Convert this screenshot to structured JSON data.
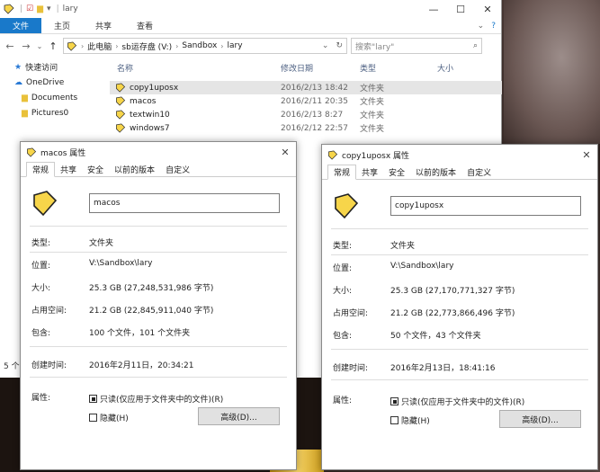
{
  "explorer": {
    "title": "lary",
    "window_controls": {
      "minimize": "—",
      "maximize": "☐",
      "close": "✕"
    },
    "ribbon_tabs": [
      "文件",
      "主页",
      "共享",
      "查看"
    ],
    "address": {
      "crumbs": [
        "此电脑",
        "sb运存盘 (V:)",
        "Sandbox",
        "lary"
      ],
      "sep": "›"
    },
    "search_placeholder": "搜索\"lary\"",
    "nav": [
      {
        "label": "快速访问",
        "icon": "star-icon",
        "sub": false
      },
      {
        "label": "OneDrive",
        "icon": "cloud-icon",
        "sub": false
      },
      {
        "label": "Documents",
        "icon": "folder-icon",
        "sub": true
      },
      {
        "label": "Pictures0",
        "icon": "folder-icon",
        "sub": true
      }
    ],
    "columns": {
      "name": "名称",
      "date": "修改日期",
      "type": "类型",
      "size": "大小"
    },
    "files": [
      {
        "name": "copy1uposx",
        "date": "2016/2/13 18:42",
        "type": "文件夹",
        "size": ""
      },
      {
        "name": "macos",
        "date": "2016/2/11 20:35",
        "type": "文件夹",
        "size": ""
      },
      {
        "name": "textwin10",
        "date": "2016/2/13 8:27",
        "type": "文件夹",
        "size": ""
      },
      {
        "name": "windows7",
        "date": "2016/2/12 22:57",
        "type": "文件夹",
        "size": ""
      }
    ],
    "status_text": "5 个"
  },
  "dialog_left": {
    "title": "macos 属性",
    "tabs": [
      "常规",
      "共享",
      "安全",
      "以前的版本",
      "自定义"
    ],
    "name": "macos",
    "rows": [
      {
        "label": "类型:",
        "value": "文件夹"
      },
      {
        "label": "位置:",
        "value": "V:\\Sandbox\\lary"
      },
      {
        "label": "大小:",
        "value": "25.3 GB (27,248,531,986 字节)"
      },
      {
        "label": "占用空间:",
        "value": "21.2 GB (22,845,911,040 字节)"
      },
      {
        "label": "包含:",
        "value": "100 个文件，101 个文件夹"
      },
      {
        "label": "创建时间:",
        "value": "2016年2月11日，20:34:21"
      },
      {
        "label": "属性:",
        "value": ""
      }
    ],
    "readonly_label": "只读(仅应用于文件夹中的文件)(R)",
    "readonly_checked": true,
    "hidden_label": "隐藏(H)",
    "hidden_checked": false,
    "advanced_button": "高级(D)...",
    "close": "✕"
  },
  "dialog_right": {
    "title": "copy1uposx 属性",
    "tabs": [
      "常规",
      "共享",
      "安全",
      "以前的版本",
      "自定义"
    ],
    "name": "copy1uposx",
    "rows": [
      {
        "label": "类型:",
        "value": "文件夹"
      },
      {
        "label": "位置:",
        "value": "V:\\Sandbox\\lary"
      },
      {
        "label": "大小:",
        "value": "25.3 GB (27,170,771,327 字节)"
      },
      {
        "label": "占用空间:",
        "value": "21.2 GB (22,773,866,496 字节)"
      },
      {
        "label": "包含:",
        "value": "50 个文件，43 个文件夹"
      },
      {
        "label": "创建时间:",
        "value": "2016年2月13日，18:41:16"
      },
      {
        "label": "属性:",
        "value": ""
      }
    ],
    "readonly_label": "只读(仅应用于文件夹中的文件)(R)",
    "readonly_checked": true,
    "hidden_label": "隐藏(H)",
    "hidden_checked": false,
    "advanced_button": "高级(D)...",
    "close": "✕"
  },
  "colors": {
    "accent": "#1979ca",
    "selection": "#cce8ff",
    "folder_yellow": "#f7d54a"
  }
}
